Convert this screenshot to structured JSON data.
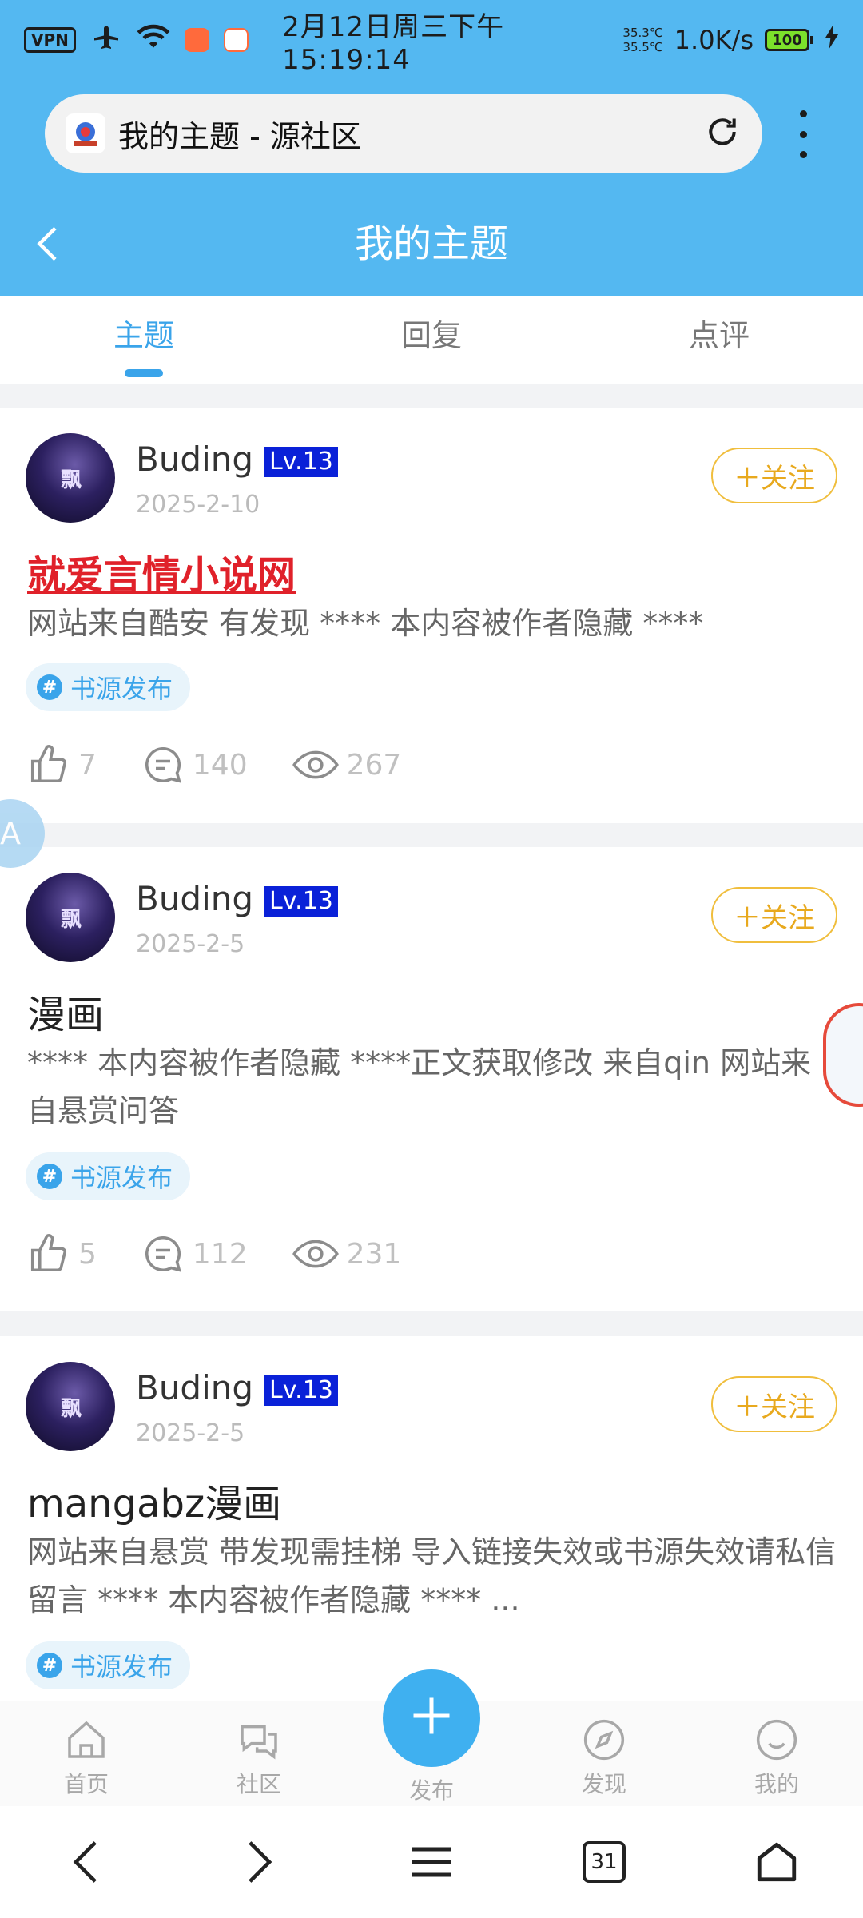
{
  "status_bar": {
    "vpn": "VPN",
    "datetime": "2月12日周三下午15:19:14",
    "temp_top": "35.3℃",
    "temp_bottom": "35.5℃",
    "net_speed": "1.0K/s",
    "battery": "100"
  },
  "browser": {
    "url_title": "我的主题 - 源社区"
  },
  "header": {
    "title": "我的主题"
  },
  "tabs": [
    {
      "label": "主题",
      "active": true
    },
    {
      "label": "回复",
      "active": false
    },
    {
      "label": "点评",
      "active": false
    }
  ],
  "follow_label": "＋关注",
  "posts": [
    {
      "username": "Buding",
      "level": "Lv.13",
      "date": "2025-2-10",
      "title": "就爱言情小说网",
      "body": "网站来自酷安 有发现 **** 本内容被作者隐藏 ****",
      "tag": "书源发布",
      "likes": "7",
      "comments": "140",
      "views": "267"
    },
    {
      "username": "Buding",
      "level": "Lv.13",
      "date": "2025-2-5",
      "title": "漫画",
      "body": "**** 本内容被作者隐藏 ****正文获取修改 来自qin 网站来自悬赏问答",
      "tag": "书源发布",
      "likes": "5",
      "comments": "112",
      "views": "231"
    },
    {
      "username": "Buding",
      "level": "Lv.13",
      "date": "2025-2-5",
      "title": "mangabz漫画",
      "body": "网站来自悬赏 带发现需挂梯 导入链接失效或书源失效请私信留言 **** 本内容被作者隐藏 **** ...",
      "tag": "书源发布"
    }
  ],
  "bottom_nav": [
    {
      "label": "首页",
      "icon": "home-icon"
    },
    {
      "label": "社区",
      "icon": "chat-icon"
    },
    {
      "label": "发布",
      "icon": "plus-icon"
    },
    {
      "label": "发现",
      "icon": "compass-icon"
    },
    {
      "label": "我的",
      "icon": "smile-icon"
    }
  ],
  "system_nav": {
    "tab_count": "31"
  },
  "colors": {
    "header_blue": "#54b8f1",
    "accent_blue": "#3aa4ea",
    "follow_gold": "#e8a91e",
    "level_badge": "#0a21d8",
    "link_red": "#e0212a"
  }
}
